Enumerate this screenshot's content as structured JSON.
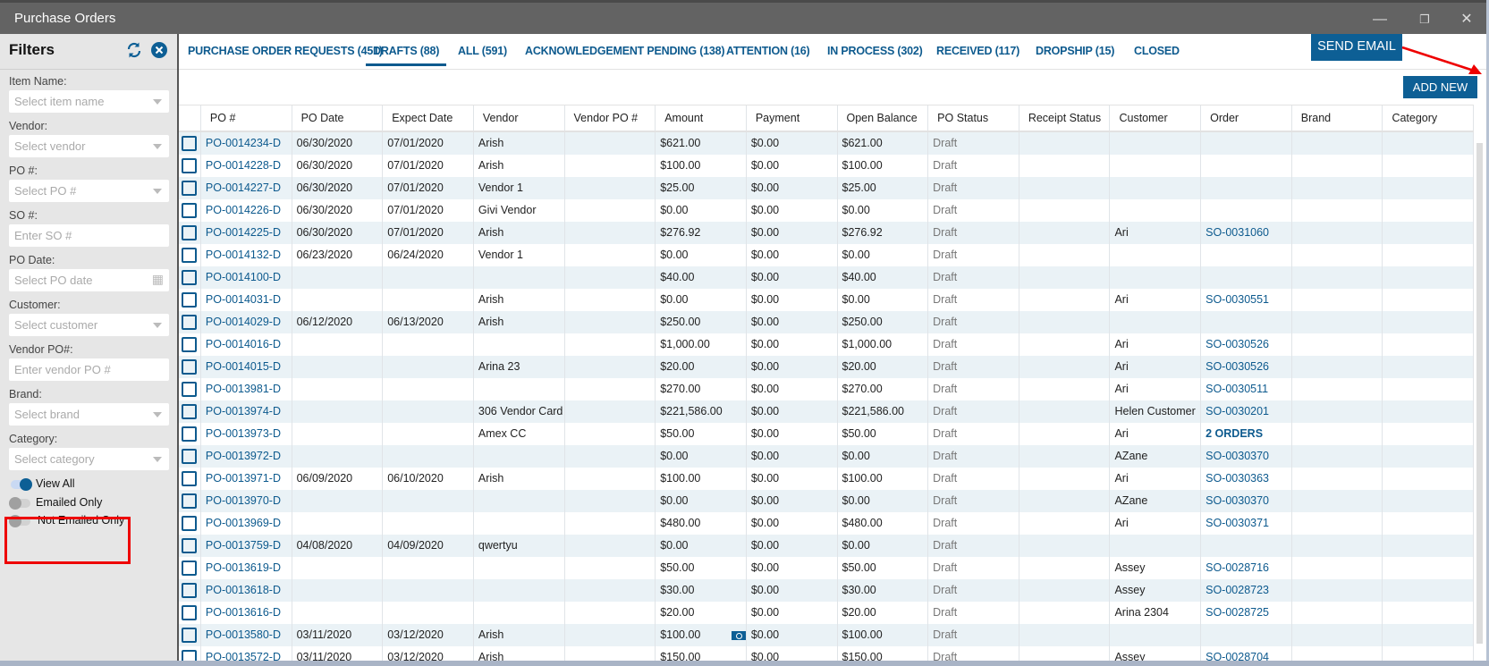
{
  "window": {
    "title": "Purchase Orders",
    "minimize": "—",
    "restore": "❐",
    "close": "✕"
  },
  "sidebar": {
    "title": "Filters",
    "icons": {
      "refresh": "refresh-icon",
      "clear": "close-circle-icon"
    },
    "fields": [
      {
        "label": "Item Name:",
        "placeholder": "Select item name",
        "type": "select"
      },
      {
        "label": "Vendor:",
        "placeholder": "Select vendor",
        "type": "select"
      },
      {
        "label": "PO #:",
        "placeholder": "Select PO #",
        "type": "select"
      },
      {
        "label": "SO #:",
        "placeholder": "Enter SO #",
        "type": "text"
      },
      {
        "label": "PO Date:",
        "placeholder": "Select PO date",
        "type": "date"
      },
      {
        "label": "Customer:",
        "placeholder": "Select customer",
        "type": "select"
      },
      {
        "label": "Vendor PO#:",
        "placeholder": "Enter vendor PO #",
        "type": "text"
      },
      {
        "label": "Brand:",
        "placeholder": "Select brand",
        "type": "select"
      },
      {
        "label": "Category:",
        "placeholder": "Select category",
        "type": "select"
      }
    ],
    "toggles": [
      {
        "label": "View All",
        "on": true
      },
      {
        "label": "Emailed Only",
        "on": false
      },
      {
        "label": "Not Emailed Only",
        "on": false
      }
    ]
  },
  "tabs": [
    {
      "label": "PURCHASE ORDER REQUESTS (451)",
      "active": false
    },
    {
      "label": "DRAFTS (88)",
      "active": true
    },
    {
      "label": "ALL (591)",
      "active": false
    },
    {
      "label": "ACKNOWLEDGEMENT PENDING (138)",
      "active": false
    },
    {
      "label": "ATTENTION (16)",
      "active": false
    },
    {
      "label": "IN PROCESS (302)",
      "active": false
    },
    {
      "label": "RECEIVED (117)",
      "active": false
    },
    {
      "label": "DROPSHIP (15)",
      "active": false
    },
    {
      "label": "CLOSED",
      "active": false
    }
  ],
  "toolbar": {
    "send_email": "SEND EMAIL",
    "add_new": "ADD NEW"
  },
  "colors": {
    "accent": "#0d5f95",
    "row_alt": "#eaf2f6",
    "annotation": "#ee0000"
  },
  "table": {
    "columns": [
      "PO #",
      "PO Date",
      "Expect Date",
      "Vendor",
      "Vendor PO #",
      "Amount",
      "Payment",
      "Open Balance",
      "PO Status",
      "Receipt Status",
      "Customer",
      "Order",
      "Brand",
      "Category"
    ],
    "rows": [
      [
        "PO-0014234-D",
        "06/30/2020",
        "07/01/2020",
        "Arish",
        "",
        "$621.00",
        "$0.00",
        "$621.00",
        "Draft",
        "",
        "",
        "",
        "",
        ""
      ],
      [
        "PO-0014228-D",
        "06/30/2020",
        "07/01/2020",
        "Arish",
        "",
        "$100.00",
        "$0.00",
        "$100.00",
        "Draft",
        "",
        "",
        "",
        "",
        ""
      ],
      [
        "PO-0014227-D",
        "06/30/2020",
        "07/01/2020",
        "Vendor 1",
        "",
        "$25.00",
        "$0.00",
        "$25.00",
        "Draft",
        "",
        "",
        "",
        "",
        ""
      ],
      [
        "PO-0014226-D",
        "06/30/2020",
        "07/01/2020",
        "Givi Vendor",
        "",
        "$0.00",
        "$0.00",
        "$0.00",
        "Draft",
        "",
        "",
        "",
        "",
        ""
      ],
      [
        "PO-0014225-D",
        "06/30/2020",
        "07/01/2020",
        "Arish",
        "",
        "$276.92",
        "$0.00",
        "$276.92",
        "Draft",
        "",
        "Ari",
        "SO-0031060",
        "",
        ""
      ],
      [
        "PO-0014132-D",
        "06/23/2020",
        "06/24/2020",
        "Vendor 1",
        "",
        "$0.00",
        "$0.00",
        "$0.00",
        "Draft",
        "",
        "",
        "",
        "",
        ""
      ],
      [
        "PO-0014100-D",
        "",
        "",
        "",
        "",
        "$40.00",
        "$0.00",
        "$40.00",
        "Draft",
        "",
        "",
        "",
        "",
        ""
      ],
      [
        "PO-0014031-D",
        "",
        "",
        "Arish",
        "",
        "$0.00",
        "$0.00",
        "$0.00",
        "Draft",
        "",
        "Ari",
        "SO-0030551",
        "",
        ""
      ],
      [
        "PO-0014029-D",
        "06/12/2020",
        "06/13/2020",
        "Arish",
        "",
        "$250.00",
        "$0.00",
        "$250.00",
        "Draft",
        "",
        "",
        "",
        "",
        ""
      ],
      [
        "PO-0014016-D",
        "",
        "",
        "",
        "",
        "$1,000.00",
        "$0.00",
        "$1,000.00",
        "Draft",
        "",
        "Ari",
        "SO-0030526",
        "",
        ""
      ],
      [
        "PO-0014015-D",
        "",
        "",
        "Arina 23",
        "",
        "$20.00",
        "$0.00",
        "$20.00",
        "Draft",
        "",
        "Ari",
        "SO-0030526",
        "",
        ""
      ],
      [
        "PO-0013981-D",
        "",
        "",
        "",
        "",
        "$270.00",
        "$0.00",
        "$270.00",
        "Draft",
        "",
        "Ari",
        "SO-0030511",
        "",
        ""
      ],
      [
        "PO-0013974-D",
        "",
        "",
        "306 Vendor Card",
        "",
        "$221,586.00",
        "$0.00",
        "$221,586.00",
        "Draft",
        "",
        "Helen Customer",
        "SO-0030201",
        "",
        ""
      ],
      [
        "PO-0013973-D",
        "",
        "",
        "Amex CC",
        "",
        "$50.00",
        "$0.00",
        "$50.00",
        "Draft",
        "",
        "Ari",
        "2 ORDERS",
        "",
        ""
      ],
      [
        "PO-0013972-D",
        "",
        "",
        "",
        "",
        "$0.00",
        "$0.00",
        "$0.00",
        "Draft",
        "",
        "AZane",
        "SO-0030370",
        "",
        ""
      ],
      [
        "PO-0013971-D",
        "06/09/2020",
        "06/10/2020",
        "Arish",
        "",
        "$100.00",
        "$0.00",
        "$100.00",
        "Draft",
        "",
        "Ari",
        "SO-0030363",
        "",
        ""
      ],
      [
        "PO-0013970-D",
        "",
        "",
        "",
        "",
        "$0.00",
        "$0.00",
        "$0.00",
        "Draft",
        "",
        "AZane",
        "SO-0030370",
        "",
        ""
      ],
      [
        "PO-0013969-D",
        "",
        "",
        "",
        "",
        "$480.00",
        "$0.00",
        "$480.00",
        "Draft",
        "",
        "Ari",
        "SO-0030371",
        "",
        ""
      ],
      [
        "PO-0013759-D",
        "04/08/2020",
        "04/09/2020",
        "qwertyu",
        "",
        "$0.00",
        "$0.00",
        "$0.00",
        "Draft",
        "",
        "",
        "",
        "",
        ""
      ],
      [
        "PO-0013619-D",
        "",
        "",
        "",
        "",
        "$50.00",
        "$0.00",
        "$50.00",
        "Draft",
        "",
        "Assey",
        "SO-0028716",
        "",
        ""
      ],
      [
        "PO-0013618-D",
        "",
        "",
        "",
        "",
        "$30.00",
        "$0.00",
        "$30.00",
        "Draft",
        "",
        "Assey",
        "SO-0028723",
        "",
        ""
      ],
      [
        "PO-0013616-D",
        "",
        "",
        "",
        "",
        "$20.00",
        "$0.00",
        "$20.00",
        "Draft",
        "",
        "Arina 2304",
        "SO-0028725",
        "",
        ""
      ],
      [
        "PO-0013580-D",
        "03/11/2020",
        "03/12/2020",
        "Arish",
        "",
        "$100.00",
        "$0.00",
        "$100.00",
        "Draft",
        "",
        "",
        "",
        "",
        ""
      ],
      [
        "PO-0013572-D",
        "03/11/2020",
        "03/12/2020",
        "Arish",
        "",
        "$150.00",
        "$0.00",
        "$150.00",
        "Draft",
        "",
        "Assey",
        "SO-0028704",
        "",
        ""
      ]
    ],
    "payment_icon_rows": [
      "PO-0013580-D"
    ]
  }
}
